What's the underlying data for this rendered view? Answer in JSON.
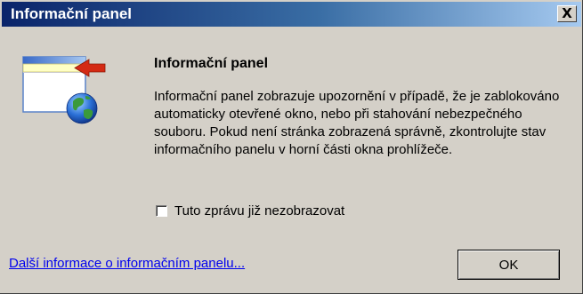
{
  "window": {
    "title": "Informační panel",
    "close_label": "X"
  },
  "content": {
    "heading": "Informační panel",
    "body": "Informační panel zobrazuje upozornění v případě, že je zablokováno automaticky otevřené okno, nebo při stahování nebezpečného souboru. Pokud není stránka zobrazená správně, zkontrolujte stav informačního panelu v horní části okna prohlížeče.",
    "checkbox_label": "Tuto zprávu již nezobrazovat",
    "checkbox_checked": false,
    "link_text": "Další informace o informačním panelu...",
    "ok_label": "OK",
    "illustration_icons": [
      "browser-window-icon",
      "arrow-icon",
      "globe-icon"
    ]
  },
  "colors": {
    "titlebar_start": "#0a246a",
    "titlebar_end": "#a6caf0",
    "dialog_bg": "#d4d0c8",
    "link": "#0000ee",
    "arrow": "#d42a14",
    "info_bar": "#ffffc4"
  }
}
